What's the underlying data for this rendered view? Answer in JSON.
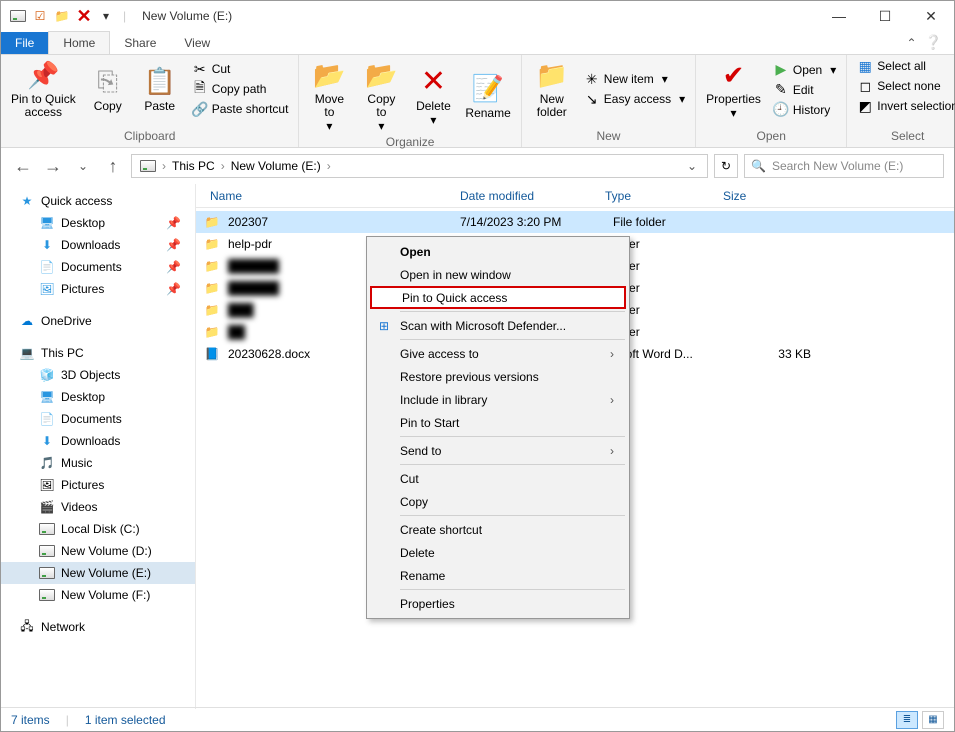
{
  "window": {
    "title": "New Volume (E:)"
  },
  "tabs": {
    "file": "File",
    "home": "Home",
    "share": "Share",
    "view": "View"
  },
  "ribbon": {
    "clipboard": {
      "label": "Clipboard",
      "pin": "Pin to Quick\naccess",
      "copy": "Copy",
      "paste": "Paste",
      "cut": "Cut",
      "copypath": "Copy path",
      "shortcut": "Paste shortcut"
    },
    "organize": {
      "label": "Organize",
      "moveto": "Move\nto",
      "copyto": "Copy\nto",
      "delete": "Delete",
      "rename": "Rename"
    },
    "new": {
      "label": "New",
      "newfolder": "New\nfolder",
      "newitem": "New item",
      "easyaccess": "Easy access"
    },
    "open": {
      "label": "Open",
      "properties": "Properties",
      "open": "Open",
      "edit": "Edit",
      "history": "History"
    },
    "select": {
      "label": "Select",
      "selectall": "Select all",
      "selectnone": "Select none",
      "invert": "Invert selection"
    }
  },
  "breadcrumb": {
    "root": "This PC",
    "current": "New Volume (E:)"
  },
  "search": {
    "placeholder": "Search New Volume (E:)"
  },
  "nav": {
    "quick": "Quick access",
    "desktop": "Desktop",
    "downloads": "Downloads",
    "documents": "Documents",
    "pictures": "Pictures",
    "onedrive": "OneDrive",
    "thispc": "This PC",
    "objects3d": "3D Objects",
    "desktop2": "Desktop",
    "documents2": "Documents",
    "downloads2": "Downloads",
    "music": "Music",
    "pictures2": "Pictures",
    "videos": "Videos",
    "diskC": "Local Disk (C:)",
    "diskD": "New Volume (D:)",
    "diskE": "New Volume (E:)",
    "diskF": "New Volume (F:)",
    "network": "Network"
  },
  "columns": {
    "name": "Name",
    "date": "Date modified",
    "type": "Type",
    "size": "Size"
  },
  "files": [
    {
      "name": "202307",
      "date": "7/14/2023 3:20 PM",
      "type": "File folder",
      "size": "",
      "icon": "folder",
      "selected": true
    },
    {
      "name": "help-pdr",
      "date": "",
      "type": "older",
      "size": "",
      "icon": "folder"
    },
    {
      "name": "██████",
      "date": "",
      "type": "older",
      "size": "",
      "icon": "folder",
      "blur": true
    },
    {
      "name": "██████",
      "date": "",
      "type": "older",
      "size": "",
      "icon": "folder",
      "blur": true
    },
    {
      "name": "███",
      "date": "",
      "type": "older",
      "size": "",
      "icon": "folder",
      "blur": true
    },
    {
      "name": "██",
      "date": "",
      "type": "older",
      "size": "",
      "icon": "folder",
      "blur": true
    },
    {
      "name": "20230628.docx",
      "date": "",
      "type": "osoft Word D...",
      "size": "33 KB",
      "icon": "word"
    }
  ],
  "ctx": {
    "open": "Open",
    "newwin": "Open in new window",
    "pin": "Pin to Quick access",
    "defender": "Scan with Microsoft Defender...",
    "giveaccess": "Give access to",
    "restore": "Restore previous versions",
    "library": "Include in library",
    "start": "Pin to Start",
    "sendto": "Send to",
    "cut": "Cut",
    "copy": "Copy",
    "createshortcut": "Create shortcut",
    "delete": "Delete",
    "rename": "Rename",
    "properties": "Properties"
  },
  "status": {
    "items": "7 items",
    "selected": "1 item selected"
  }
}
